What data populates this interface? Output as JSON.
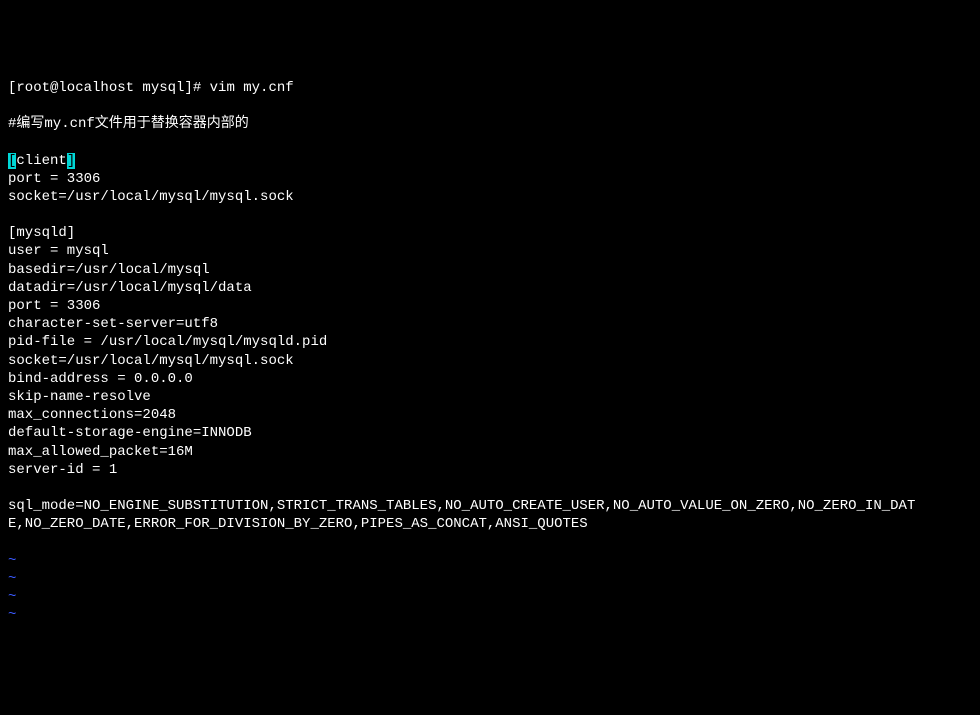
{
  "prompt": {
    "user_host": "[root@localhost mysql]#",
    "command": "vim my.cnf"
  },
  "comment": "#编写my.cnf文件用于替换容器内部的",
  "client_section": {
    "open_br": "[",
    "label": "client",
    "close_br": "]",
    "lines": [
      "port = 3306",
      "socket=/usr/local/mysql/mysql.sock"
    ]
  },
  "mysqld_section": {
    "header": "[mysqld]",
    "lines": [
      "user = mysql",
      "basedir=/usr/local/mysql",
      "datadir=/usr/local/mysql/data",
      "port = 3306",
      "character-set-server=utf8",
      "pid-file = /usr/local/mysql/mysqld.pid",
      "socket=/usr/local/mysql/mysql.sock",
      "bind-address = 0.0.0.0",
      "skip-name-resolve",
      "max_connections=2048",
      "default-storage-engine=INNODB",
      "max_allowed_packet=16M",
      "server-id = 1"
    ]
  },
  "sql_mode": {
    "line1": "sql_mode=NO_ENGINE_SUBSTITUTION,STRICT_TRANS_TABLES,NO_AUTO_CREATE_USER,NO_AUTO_VALUE_ON_ZERO,NO_ZERO_IN_DAT",
    "line2": "E,NO_ZERO_DATE,ERROR_FOR_DIVISION_BY_ZERO,PIPES_AS_CONCAT,ANSI_QUOTES"
  },
  "tildes": [
    "~",
    "~",
    "~",
    "~"
  ]
}
